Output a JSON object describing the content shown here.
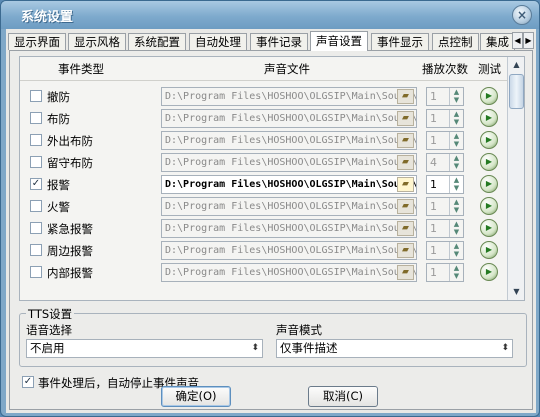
{
  "window": {
    "title": "系统设置",
    "close_icon": "×"
  },
  "tabs": [
    {
      "label": "显示界面"
    },
    {
      "label": "显示风格"
    },
    {
      "label": "系统配置"
    },
    {
      "label": "自动处理"
    },
    {
      "label": "事件记录"
    },
    {
      "label": "声音设置",
      "active": true
    },
    {
      "label": "事件显示"
    },
    {
      "label": "点控制"
    },
    {
      "label": "集成"
    }
  ],
  "tab_scroll": {
    "left": "◀",
    "right": "▶"
  },
  "table": {
    "columns": [
      "事件类型",
      "声音文件",
      "播放次数",
      "测试"
    ],
    "rows": [
      {
        "checked": false,
        "label": "撤防",
        "path": "D:\\Program Files\\HOSHOO\\OLGSIP\\Main\\Sound\\撤防.wav",
        "count": "1"
      },
      {
        "checked": false,
        "label": "布防",
        "path": "D:\\Program Files\\HOSHOO\\OLGSIP\\Main\\Sound\\布防.wav",
        "count": "1"
      },
      {
        "checked": false,
        "label": "外出布防",
        "path": "D:\\Program Files\\HOSHOO\\OLGSIP\\Main\\Sound\\外出布防.wav",
        "count": "1"
      },
      {
        "checked": false,
        "label": "留守布防",
        "path": "D:\\Program Files\\HOSHOO\\OLGSIP\\Main\\Sound\\留守布防.wav",
        "count": "4"
      },
      {
        "checked": true,
        "label": "报警",
        "path": "D:\\Program Files\\HOSHOO\\OLGSIP\\Main\\Sound\\报警.wav",
        "count": "1"
      },
      {
        "checked": false,
        "label": "火警",
        "path": "D:\\Program Files\\HOSHOO\\OLGSIP\\Main\\Sound\\火警.wav",
        "count": "1"
      },
      {
        "checked": false,
        "label": "紧急报警",
        "path": "D:\\Program Files\\HOSHOO\\OLGSIP\\Main\\Sound\\紧急报警.wav",
        "count": "1"
      },
      {
        "checked": false,
        "label": "周边报警",
        "path": "D:\\Program Files\\HOSHOO\\OLGSIP\\Main\\Sound\\周边报警.wav",
        "count": "1"
      },
      {
        "checked": false,
        "label": "内部报警",
        "path": "D:\\Program Files\\HOSHOO\\OLGSIP\\Main\\Sound\\内部报警.wav",
        "count": "1"
      }
    ]
  },
  "tts": {
    "title": "TTS设置",
    "voice_label": "语音选择",
    "voice_value": "不启用",
    "mode_label": "声音模式",
    "mode_value": "仅事件描述"
  },
  "auto_stop": {
    "label": "事件处理后，自动停止事件声音",
    "checked": true
  },
  "buttons": {
    "ok": "确定(O)",
    "cancel": "取消(C)"
  },
  "colors": {
    "title_bar": "#7eaacd",
    "accent": "#5d8fbe",
    "play_icon": "#247a22"
  }
}
